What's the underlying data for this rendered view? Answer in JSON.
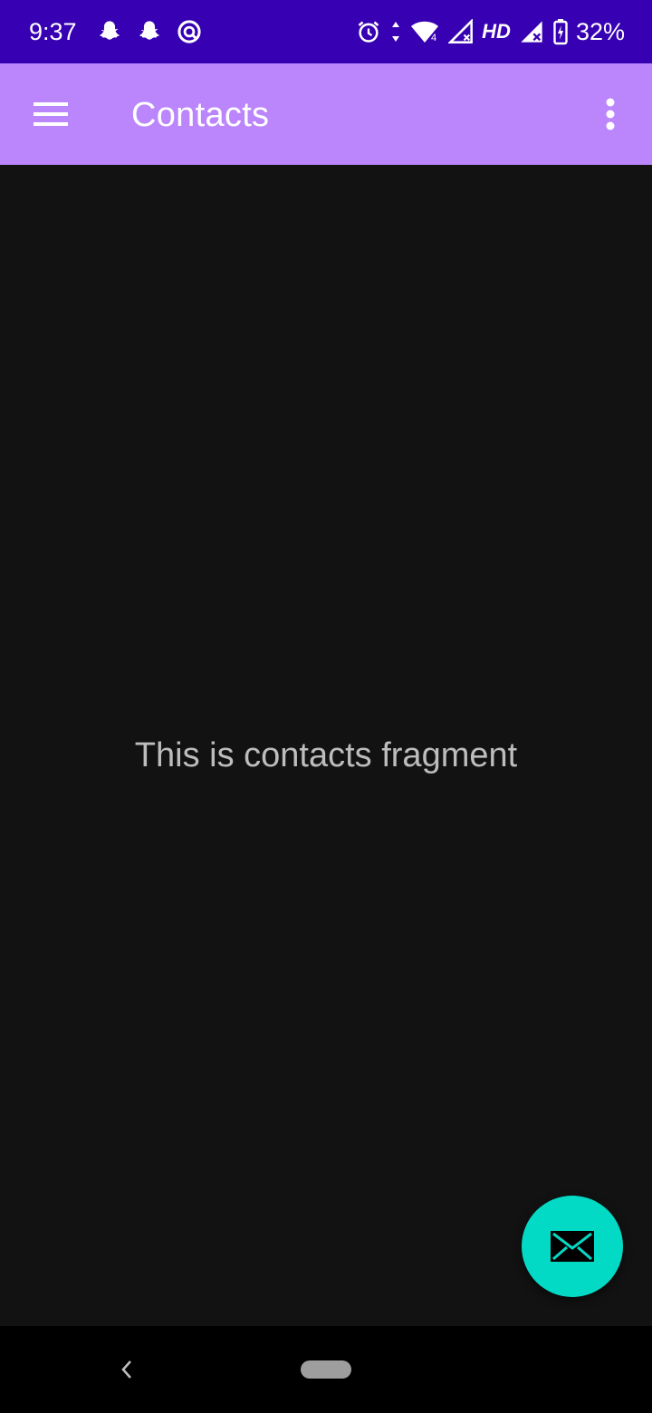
{
  "status_bar": {
    "time": "9:37",
    "left_icons": [
      "snapchat-icon",
      "snapchat-icon",
      "vpn-icon"
    ],
    "right_icons": [
      "alarm-icon",
      "data-arrows-icon",
      "wifi-icon",
      "signal-icon",
      "signal-icon",
      "battery-charging-icon"
    ],
    "network_label": "HD",
    "battery_percent": "32%",
    "colors": {
      "background": "#3700b3",
      "foreground": "#ffffff"
    }
  },
  "app_bar": {
    "title": "Contacts",
    "menu_icon": "hamburger-menu-icon",
    "overflow_icon": "more-vertical-icon",
    "colors": {
      "background": "#bb86fc",
      "foreground": "#ffffff"
    }
  },
  "content": {
    "message": "This is contacts fragment",
    "colors": {
      "background": "#121212",
      "text": "#bdbdbd"
    }
  },
  "fab": {
    "icon": "mail-icon",
    "colors": {
      "background": "#03dac5",
      "icon": "#000000"
    }
  },
  "nav_bar": {
    "back_icon": "back-chevron-icon",
    "home_icon": "home-pill-icon"
  }
}
